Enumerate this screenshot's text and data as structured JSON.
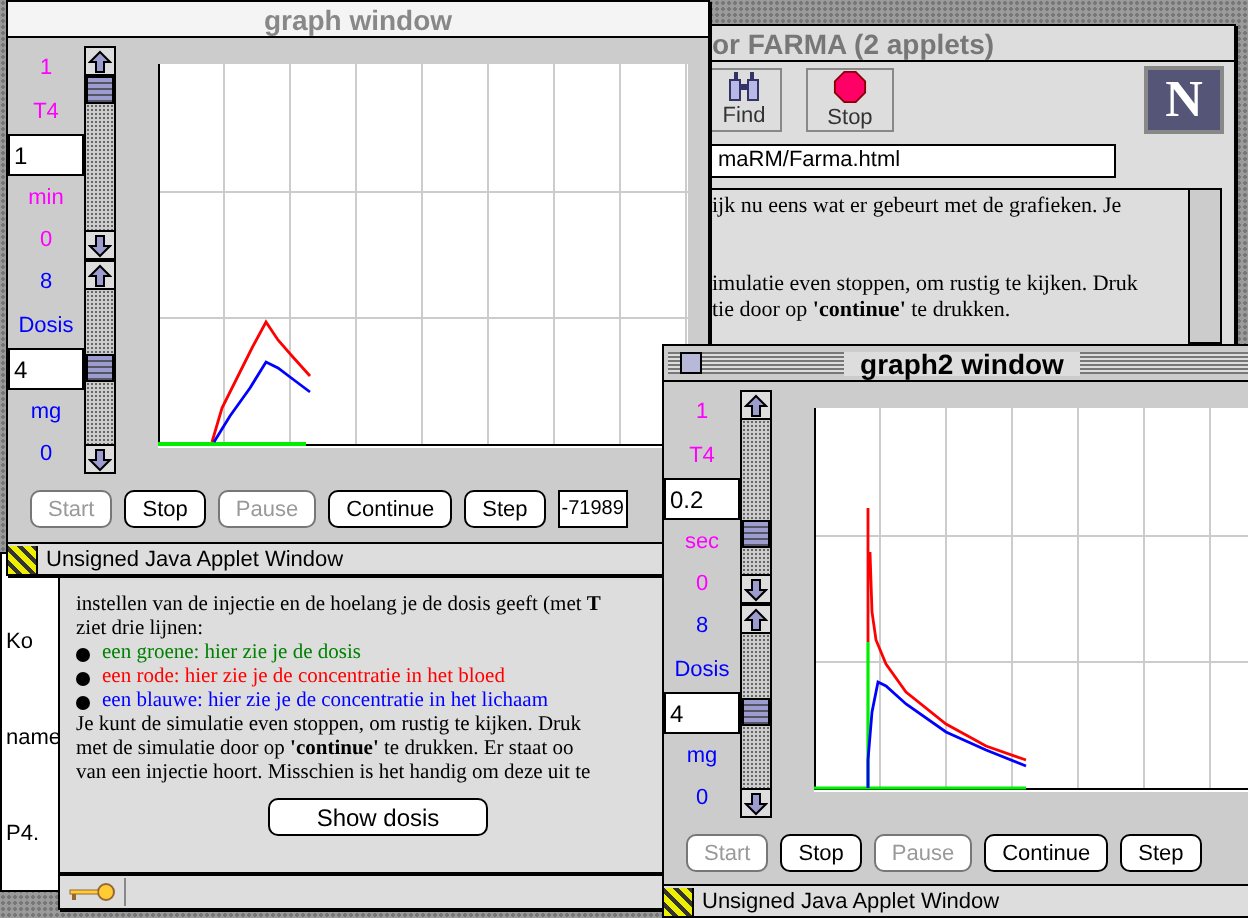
{
  "back_window": {
    "texts": [
      "Ko",
      "name",
      "P4."
    ]
  },
  "browser": {
    "title": "or FARMA (2 applets)",
    "toolbar": [
      {
        "kind": "find",
        "label": "Find"
      },
      {
        "kind": "stop",
        "label": "Stop"
      }
    ],
    "logo": "N",
    "url": "maRM/Farma.html",
    "upper_paragraphs": [
      [
        "ijk nu eens wat er gebeurt met de grafieken.  Je"
      ],
      [
        "imulatie even stoppen, om rustig te kijken. Druk",
        "tie door op **'continue'** te drukken."
      ]
    ],
    "lower_lines": [
      {
        "kind": "text",
        "text": "instellen van de injectie en de hoelang je de dosis geeft (met **T**"
      },
      {
        "kind": "text",
        "text": "ziet drie lijnen:"
      },
      {
        "kind": "bullet",
        "text": "een groene: hier zie je de dosis",
        "color": "#008000"
      },
      {
        "kind": "bullet",
        "text": "een rode: hier zie je de concentratie in het bloed",
        "color": "#ff0000"
      },
      {
        "kind": "bullet",
        "text": "een blauwe: hier zie je de concentratie in het lichaam",
        "color": "#0000ff"
      },
      {
        "kind": "text",
        "text": "Je kunt de simulatie even stoppen, om rustig te kijken. Druk"
      },
      {
        "kind": "text",
        "text": "met de simulatie door op **'continue'** te drukken. Er staat oo"
      },
      {
        "kind": "text",
        "text": "van een injectie hoort. Misschien is het handig om deze uit te"
      }
    ],
    "button": "Show dosis"
  },
  "graph_windows": [
    {
      "title": "graph window",
      "active": false,
      "params": [
        {
          "max": "1",
          "name": "T4",
          "value": "1",
          "unit": "min",
          "min": "0",
          "color": "#ff00ff",
          "level": 1
        },
        {
          "max": "8",
          "name": "Dosis",
          "value": "4",
          "unit": "mg",
          "min": "0",
          "color": "#0000ff",
          "level": 0.5
        }
      ],
      "buttons": [
        {
          "label": "Start",
          "disabled": true
        },
        {
          "label": "Stop",
          "disabled": false
        },
        {
          "label": "Pause",
          "disabled": true
        },
        {
          "label": "Continue",
          "disabled": false
        },
        {
          "label": "Step",
          "disabled": false
        }
      ],
      "field": "-71989",
      "status": "Unsigned Java Applet Window"
    },
    {
      "title": "graph2 window",
      "active": true,
      "params": [
        {
          "max": "1",
          "name": "T4",
          "value": "0.2",
          "unit": "sec",
          "min": "0",
          "color": "#ff00ff",
          "level": 0.2
        },
        {
          "max": "8",
          "name": "Dosis",
          "value": "4",
          "unit": "mg",
          "min": "0",
          "color": "#0000ff",
          "level": 0.5
        }
      ],
      "buttons": [
        {
          "label": "Start",
          "disabled": true
        },
        {
          "label": "Stop",
          "disabled": false
        },
        {
          "label": "Pause",
          "disabled": true
        },
        {
          "label": "Continue",
          "disabled": false
        },
        {
          "label": "Step",
          "disabled": false
        }
      ],
      "status": "Unsigned Java Applet Window"
    }
  ]
}
